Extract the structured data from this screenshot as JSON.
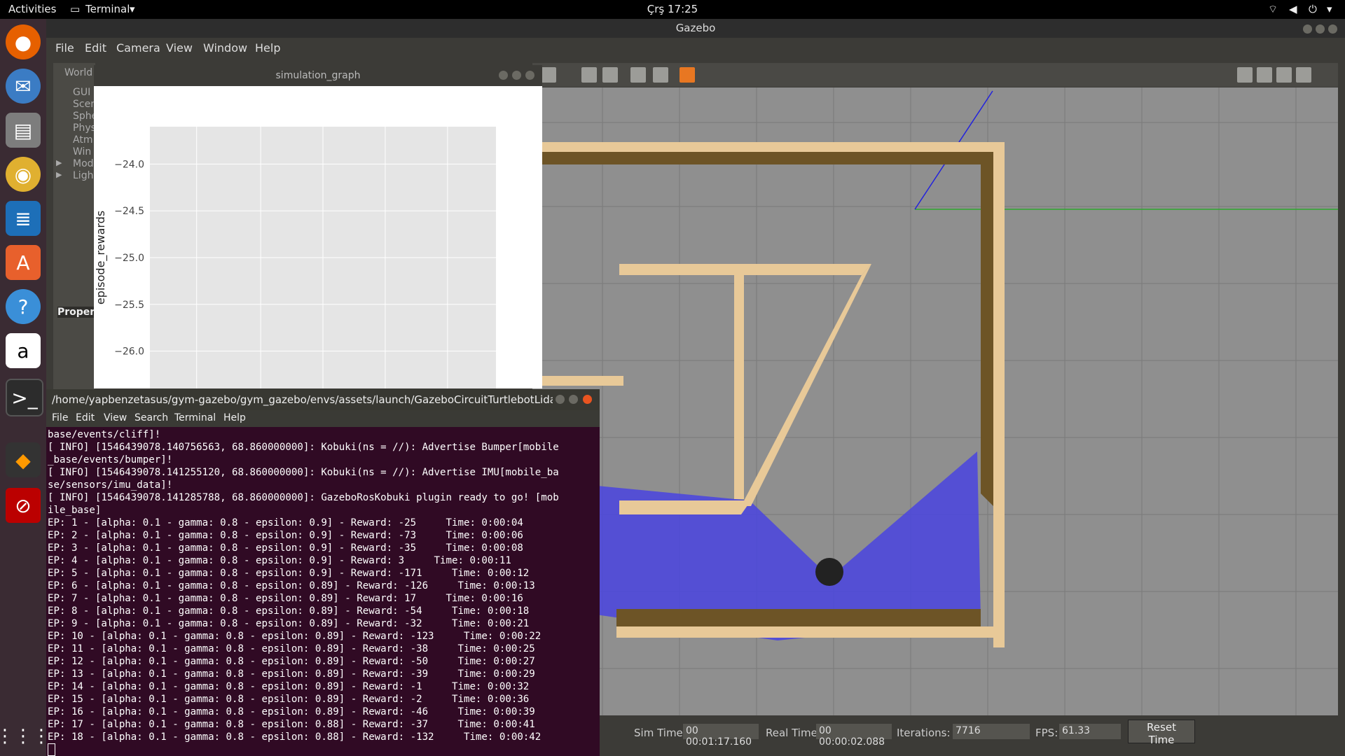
{
  "topbar": {
    "activities": "Activities",
    "app_menu": "Terminal",
    "clock": "Çrş 17:25"
  },
  "dock": {
    "items": [
      "firefox-icon",
      "thunderbird-icon",
      "files-icon",
      "rhythmbox-icon",
      "writer-icon",
      "software-center-icon",
      "help-icon",
      "amazon-icon",
      "terminal-icon",
      "blender-icon",
      "block-icon"
    ],
    "apps_grid": "show-apps-icon"
  },
  "gazebo": {
    "title": "Gazebo",
    "menu": [
      "File",
      "Edit",
      "Camera",
      "View",
      "Window",
      "Help"
    ],
    "left_panel": {
      "tab": "World",
      "items": [
        "GUI",
        "Scen",
        "Sphe",
        "Phys",
        "Atm",
        "Win",
        "Mod",
        "Ligh"
      ],
      "properties": "Proper"
    },
    "status": {
      "sim_time_label": "Sim Time:",
      "sim_time": "00 00:01:17.160",
      "real_time_label": "Real Time:",
      "real_time": "00 00:00:02.088",
      "iterations_label": "Iterations:",
      "iterations": "7716",
      "fps_label": "FPS:",
      "fps": "61.33",
      "reset_button": "Reset Time"
    },
    "colors": {
      "wall": "#e8c998",
      "wall_shadow": "#6d5426",
      "laser": "#4a44e0",
      "ground": "#8f8f8f"
    }
  },
  "plot_window": {
    "title": "simulation_graph",
    "chart_data": {
      "type": "line",
      "ylabel": "episode_rewards",
      "xlabel": "",
      "ylim": [
        -26.4,
        -23.6
      ],
      "yticks": [
        "−24.0",
        "−24.5",
        "−25.0",
        "−25.5",
        "−26.0"
      ],
      "grid": true,
      "series": []
    }
  },
  "terminal": {
    "title": "/home/yapbenzetasus/gym-gazebo/gym_gazebo/envs/assets/launch/GazeboCircuitTurtlebotLidar_...",
    "menu": [
      "File",
      "Edit",
      "View",
      "Search",
      "Terminal",
      "Help"
    ],
    "lines": [
      "base/events/cliff]!",
      "[ INFO] [1546439078.140756563, 68.860000000]: Kobuki(ns = //): Advertise Bumper[mobile",
      "_base/events/bumper]!",
      "[ INFO] [1546439078.141255120, 68.860000000]: Kobuki(ns = //): Advertise IMU[mobile_ba",
      "se/sensors/imu_data]!",
      "[ INFO] [1546439078.141285788, 68.860000000]: GazeboRosKobuki plugin ready to go! [mob",
      "ile_base]",
      "EP: 1 - [alpha: 0.1 - gamma: 0.8 - epsilon: 0.9] - Reward: -25     Time: 0:00:04",
      "EP: 2 - [alpha: 0.1 - gamma: 0.8 - epsilon: 0.9] - Reward: -73     Time: 0:00:06",
      "EP: 3 - [alpha: 0.1 - gamma: 0.8 - epsilon: 0.9] - Reward: -35     Time: 0:00:08",
      "EP: 4 - [alpha: 0.1 - gamma: 0.8 - epsilon: 0.9] - Reward: 3     Time: 0:00:11",
      "EP: 5 - [alpha: 0.1 - gamma: 0.8 - epsilon: 0.9] - Reward: -171     Time: 0:00:12",
      "EP: 6 - [alpha: 0.1 - gamma: 0.8 - epsilon: 0.89] - Reward: -126     Time: 0:00:13",
      "EP: 7 - [alpha: 0.1 - gamma: 0.8 - epsilon: 0.89] - Reward: 17     Time: 0:00:16",
      "EP: 8 - [alpha: 0.1 - gamma: 0.8 - epsilon: 0.89] - Reward: -54     Time: 0:00:18",
      "EP: 9 - [alpha: 0.1 - gamma: 0.8 - epsilon: 0.89] - Reward: -32     Time: 0:00:21",
      "EP: 10 - [alpha: 0.1 - gamma: 0.8 - epsilon: 0.89] - Reward: -123     Time: 0:00:22",
      "EP: 11 - [alpha: 0.1 - gamma: 0.8 - epsilon: 0.89] - Reward: -38     Time: 0:00:25",
      "EP: 12 - [alpha: 0.1 - gamma: 0.8 - epsilon: 0.89] - Reward: -50     Time: 0:00:27",
      "EP: 13 - [alpha: 0.1 - gamma: 0.8 - epsilon: 0.89] - Reward: -39     Time: 0:00:29",
      "EP: 14 - [alpha: 0.1 - gamma: 0.8 - epsilon: 0.89] - Reward: -1     Time: 0:00:32",
      "EP: 15 - [alpha: 0.1 - gamma: 0.8 - epsilon: 0.89] - Reward: -2     Time: 0:00:36",
      "EP: 16 - [alpha: 0.1 - gamma: 0.8 - epsilon: 0.89] - Reward: -46     Time: 0:00:39",
      "EP: 17 - [alpha: 0.1 - gamma: 0.8 - epsilon: 0.88] - Reward: -37     Time: 0:00:41",
      "EP: 18 - [alpha: 0.1 - gamma: 0.8 - epsilon: 0.88] - Reward: -132     Time: 0:00:42"
    ]
  }
}
